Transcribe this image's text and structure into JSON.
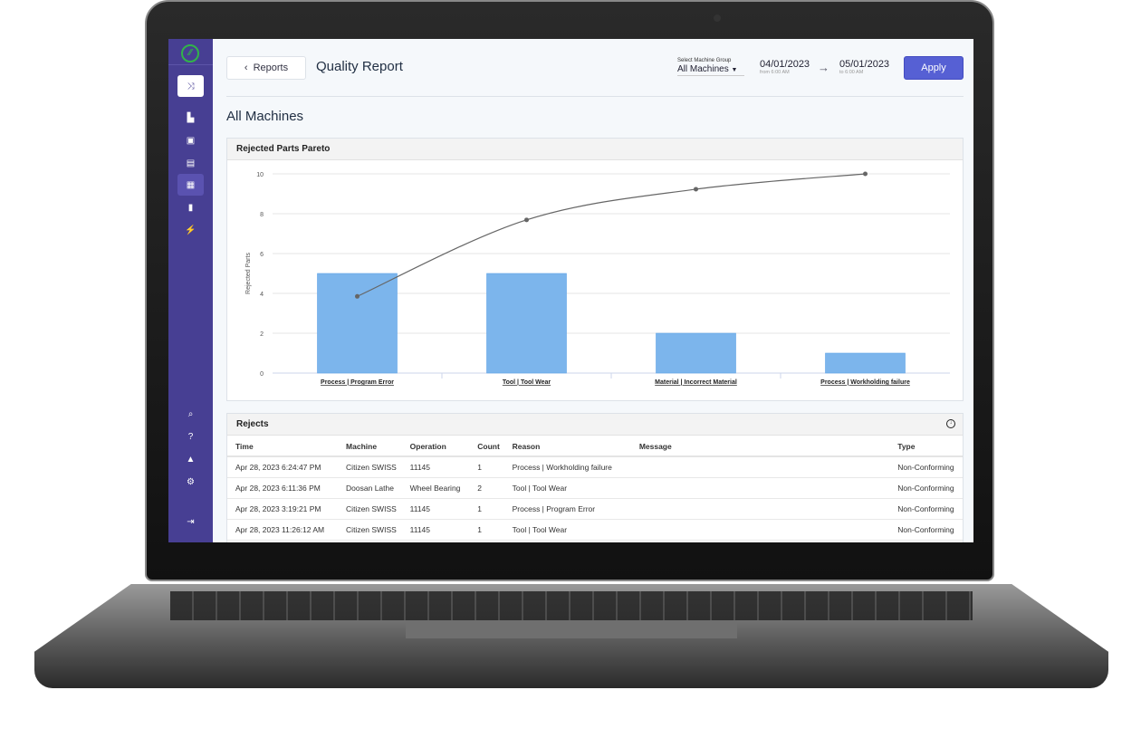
{
  "sidebar": {
    "logo": "shopfloor-logo",
    "items": [
      {
        "icon": "shuffle-icon",
        "glyph": "⤨"
      },
      {
        "icon": "factory-icon",
        "glyph": "▙"
      },
      {
        "icon": "machine-icon",
        "glyph": "▣"
      },
      {
        "icon": "calendar-icon",
        "glyph": "▤"
      },
      {
        "icon": "report-icon",
        "glyph": "▦"
      },
      {
        "icon": "bar-chart-icon",
        "glyph": "▮"
      },
      {
        "icon": "lightning-icon",
        "glyph": "⚡"
      }
    ],
    "bottom": [
      {
        "icon": "search-icon",
        "glyph": "⌕"
      },
      {
        "icon": "help-icon",
        "glyph": "?"
      },
      {
        "icon": "lock-icon",
        "glyph": "▲"
      },
      {
        "icon": "settings-icon",
        "glyph": "⚙"
      },
      {
        "icon": "logout-icon",
        "glyph": "⇥"
      }
    ]
  },
  "header": {
    "back_label": "Reports",
    "title": "Quality Report",
    "machine_group_label": "Select Machine Group",
    "machine_group_value": "All Machines",
    "from_date": "04/01/2023",
    "from_time": "from 6:00 AM",
    "to_date": "05/01/2023",
    "to_time": "to 6:00 AM",
    "apply_label": "Apply"
  },
  "section_title": "All Machines",
  "pareto": {
    "title": "Rejected Parts Pareto"
  },
  "chart_data": {
    "type": "bar",
    "title": "",
    "ylabel": "Rejected Parts",
    "ylim": [
      0,
      10
    ],
    "yticks": [
      0,
      2,
      4,
      6,
      8,
      10
    ],
    "grid": true,
    "categories": [
      "Process | Program Error",
      "Tool | Tool Wear",
      "Material | Incorrect Material",
      "Process | Workholding failure"
    ],
    "values": [
      5,
      5,
      2,
      1
    ],
    "cumulative_line": [
      3.85,
      7.69,
      9.23,
      10
    ],
    "bar_color": "#7cb5ec",
    "line_color": "#666666"
  },
  "rejects": {
    "title": "Rejects",
    "columns": [
      "Time",
      "Machine",
      "Operation",
      "Count",
      "Reason",
      "Message",
      "Type"
    ],
    "rows": [
      [
        "Apr 28, 2023 6:24:47 PM",
        "Citizen SWISS",
        "11145",
        "1",
        "Process | Workholding failure",
        "",
        "Non-Conforming"
      ],
      [
        "Apr 28, 2023 6:11:36 PM",
        "Doosan Lathe",
        "Wheel Bearing",
        "2",
        "Tool | Tool Wear",
        "",
        "Non-Conforming"
      ],
      [
        "Apr 28, 2023 3:19:21 PM",
        "Citizen SWISS",
        "11145",
        "1",
        "Process | Program Error",
        "",
        "Non-Conforming"
      ],
      [
        "Apr 28, 2023 11:26:12 AM",
        "Citizen SWISS",
        "11145",
        "1",
        "Tool | Tool Wear",
        "",
        "Non-Conforming"
      ]
    ]
  }
}
